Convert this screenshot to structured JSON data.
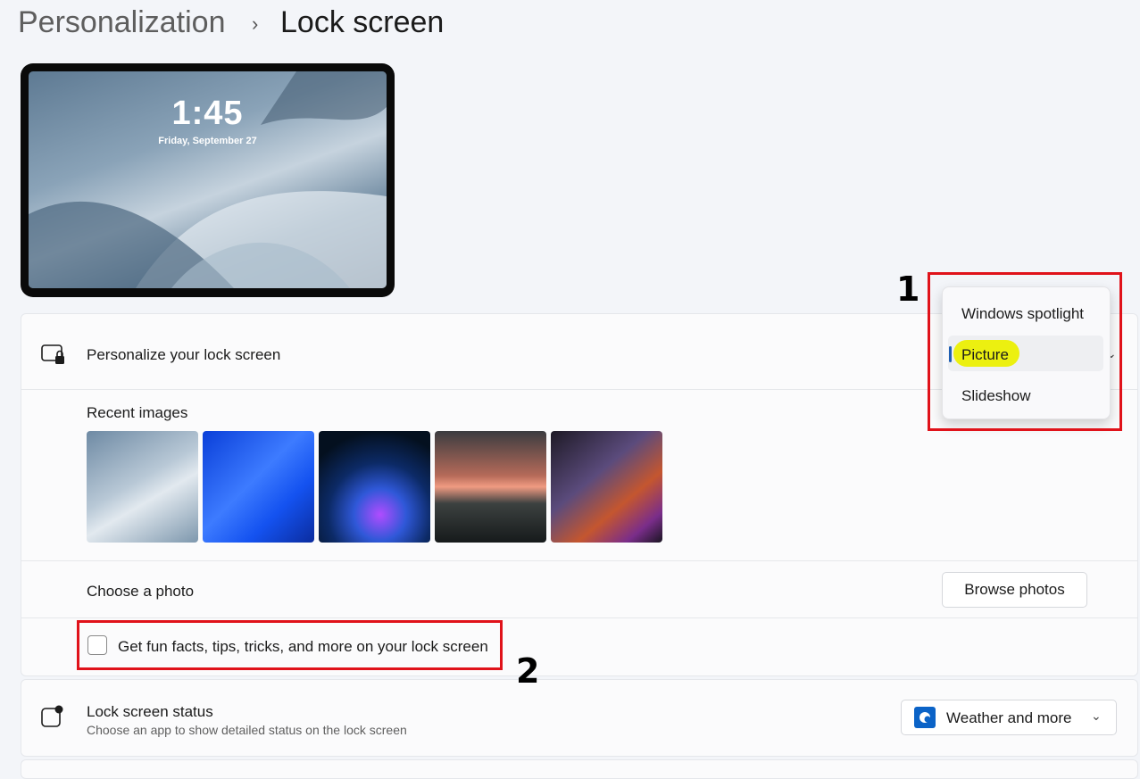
{
  "header": {
    "parent": "Personalization",
    "chevron": "›",
    "current": "Lock screen"
  },
  "preview": {
    "time": "1:45",
    "date": "Friday, September 27"
  },
  "personalize": {
    "icon": "lock-screen-monitor-icon",
    "label": "Personalize your lock screen"
  },
  "recent_images": {
    "label": "Recent images",
    "items": [
      "wallpaper-bloom-grey",
      "wallpaper-blue-waves",
      "wallpaper-neon-orb",
      "wallpaper-sunset-lake",
      "wallpaper-purple-swirl"
    ]
  },
  "choose_photo": {
    "label": "Choose a photo",
    "button": "Browse photos"
  },
  "fun_facts": {
    "label": "Get fun facts, tips, tricks, and more on your lock screen",
    "checked": false
  },
  "lock_status": {
    "icon": "status-badge-icon",
    "title": "Lock screen status",
    "description": "Choose an app to show detailed status on the lock screen",
    "selected": "Weather and more"
  },
  "dropdown": {
    "options": [
      "Windows spotlight",
      "Picture",
      "Slideshow"
    ],
    "selected": "Picture"
  },
  "annotations": {
    "label1": "1",
    "label2": "2",
    "box_color": "#e0121a",
    "highlight_color": "#ecf010"
  }
}
